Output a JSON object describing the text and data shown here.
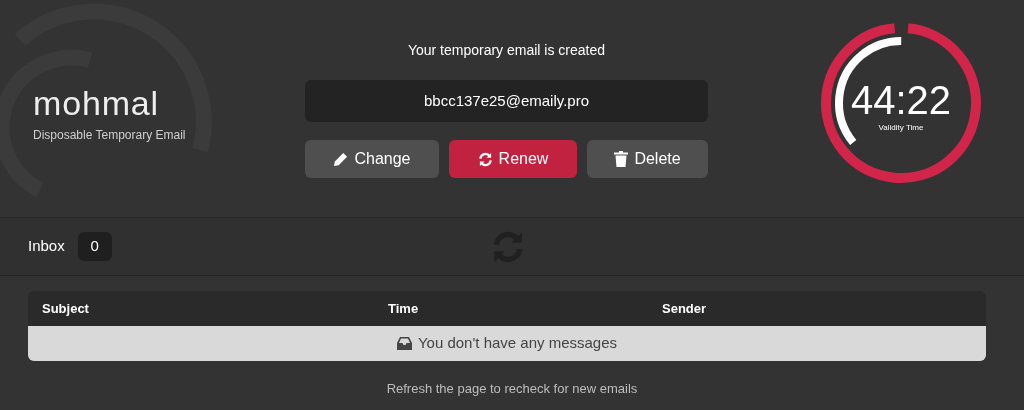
{
  "logo": {
    "wordmark": "mohmal",
    "tagline": "Disposable Temporary Email"
  },
  "status": "Your temporary email is created",
  "email": "bbcc137e25@emaily.pro",
  "buttons": [
    {
      "kind": "edit",
      "label": "Change",
      "primary": false
    },
    {
      "kind": "refresh",
      "label": "Renew",
      "primary": true
    },
    {
      "kind": "trash",
      "label": "Delete",
      "primary": false
    }
  ],
  "timer": {
    "value": "44:22",
    "caption": "Validity Time",
    "rings": [
      {
        "kind": "outer",
        "level": 0.97
      },
      {
        "kind": "inner",
        "level": 0.36
      }
    ]
  },
  "inbox": {
    "label": "Inbox",
    "count": "0"
  },
  "table": {
    "columns": [
      "Subject",
      "Time",
      "Sender"
    ],
    "empty_message": "You don't have any messages"
  },
  "footer_note": "Refresh the page to recheck for new emails"
}
